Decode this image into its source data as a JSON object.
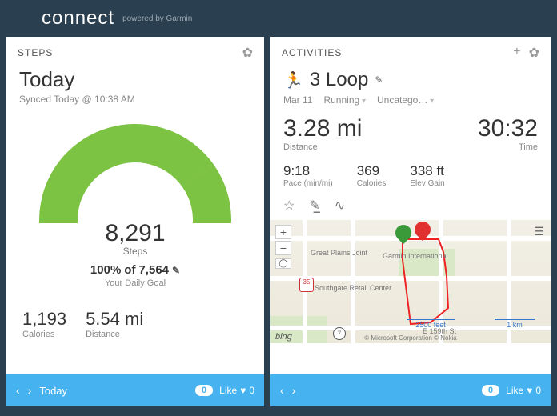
{
  "header": {
    "logo": "connect",
    "powered": "powered by Garmin"
  },
  "steps": {
    "panel_title": "STEPS",
    "title": "Today",
    "synced": "Synced Today @ 10:38 AM",
    "count": "8,291",
    "count_label": "Steps",
    "goal_pct": "100%",
    "goal_of": "of",
    "goal_target": "7,564",
    "goal_sub": "Your Daily Goal",
    "calories": "1,193",
    "calories_label": "Calories",
    "distance": "5.54 mi",
    "distance_label": "Distance",
    "footer": {
      "label": "Today",
      "comments": "0",
      "like_label": "Like",
      "like_count": "0"
    }
  },
  "activities": {
    "panel_title": "ACTIVITIES",
    "name": "3 Loop",
    "date": "Mar 11",
    "type": "Running",
    "category": "Uncatego…",
    "distance": "3.28 mi",
    "distance_label": "Distance",
    "time": "30:32",
    "time_label": "Time",
    "pace": "9:18",
    "pace_label": "Pace (min/mi)",
    "calories": "369",
    "calories_label": "Calories",
    "elev": "338 ft",
    "elev_label": "Elev Gain",
    "map": {
      "labels": {
        "great_plains": "Great Plains Joint",
        "garmin": "Garmin International",
        "southgate": "Southgate Retail Center",
        "street": "E 159th St",
        "shield": "35",
        "exit": "7"
      },
      "scale_left": "2500 feet",
      "scale_right": "1 km",
      "bing": "bing",
      "credits": "© Microsoft Corporation   © Nokia"
    },
    "footer": {
      "comments": "0",
      "like_label": "Like",
      "like_count": "0"
    }
  }
}
